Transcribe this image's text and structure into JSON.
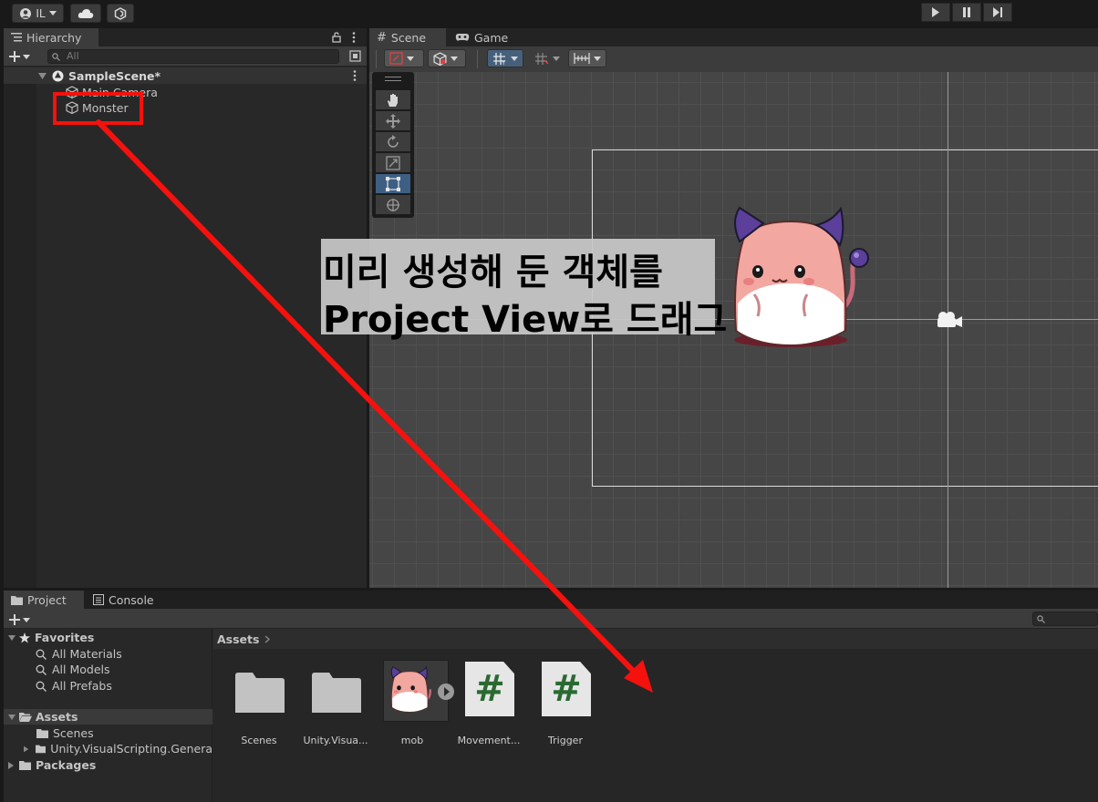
{
  "toolbar": {
    "account_label": "IL",
    "icons": [
      "account-icon",
      "dropdown-arrow-icon",
      "cloud-icon",
      "collab-icon"
    ],
    "play_controls": [
      "play-icon",
      "pause-icon",
      "step-icon"
    ]
  },
  "hierarchy": {
    "tab_label": "Hierarchy",
    "search_placeholder": "All",
    "scene_name": "SampleScene*",
    "items": [
      {
        "label": "Main Camera"
      },
      {
        "label": "Monster"
      }
    ]
  },
  "scene": {
    "tabs": [
      {
        "label": "Scene",
        "icon": "grid-hash-icon"
      },
      {
        "label": "Game",
        "icon": "gamepad-icon"
      }
    ],
    "tools": [
      "hand-tool-icon",
      "move-tool-icon",
      "rotate-tool-icon",
      "scale-tool-icon",
      "rect-tool-icon",
      "transform-tool-icon"
    ]
  },
  "project": {
    "tabs": [
      {
        "label": "Project",
        "icon": "folder-icon"
      },
      {
        "label": "Console",
        "icon": "console-icon"
      }
    ],
    "favorites_label": "Favorites",
    "favorites": [
      "All Materials",
      "All Models",
      "All Prefabs"
    ],
    "assets_label": "Assets",
    "asset_children": [
      "Scenes",
      "Unity.VisualScripting.Genera"
    ],
    "packages_label": "Packages",
    "breadcrumb": "Assets",
    "assets": [
      {
        "label": "Scenes",
        "kind": "folder"
      },
      {
        "label": "Unity.Visua...",
        "kind": "folder"
      },
      {
        "label": "mob",
        "kind": "prefab"
      },
      {
        "label": "Movement...",
        "kind": "script",
        "glyph": "#"
      },
      {
        "label": "Trigger",
        "kind": "script",
        "glyph": "#"
      }
    ]
  },
  "annotation": {
    "line1": "미리 생성해 둔 객체를",
    "line2": "Project View로 드래그",
    "color": "#f5110d"
  }
}
